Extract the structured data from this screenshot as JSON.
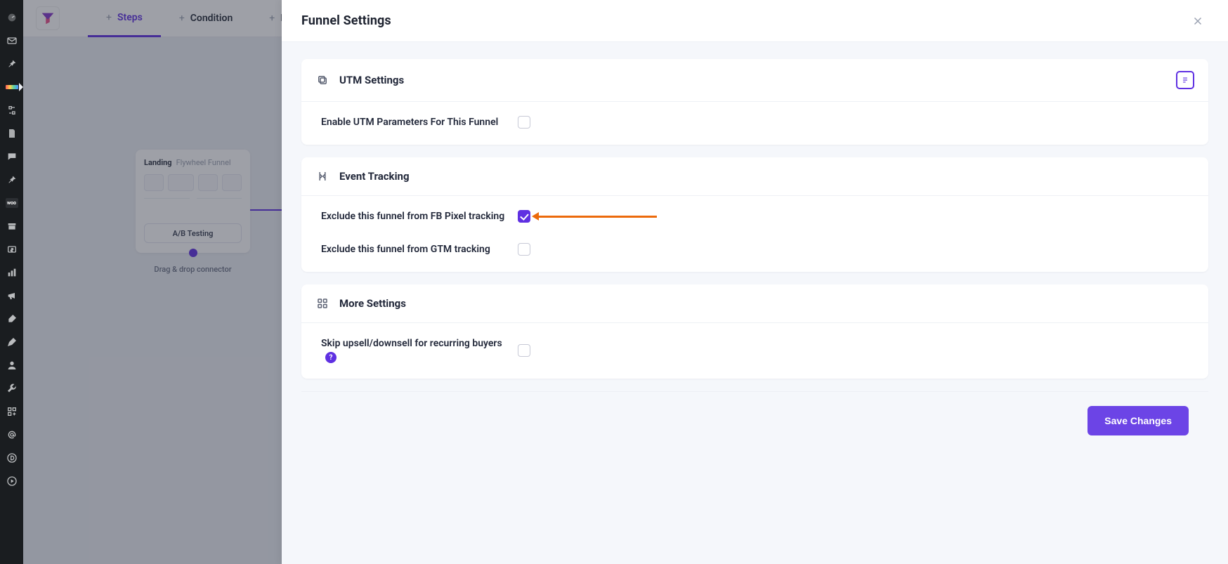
{
  "topbar": {
    "tabs": {
      "steps": "Steps",
      "condition": "Condition",
      "integrations": "Integrations"
    }
  },
  "node": {
    "tag": "Landing",
    "subtitle": "Flywheel Funnel",
    "ab_btn": "A/B Testing",
    "caption": "Drag & drop connector"
  },
  "panel": {
    "title": "Funnel Settings",
    "save_label": "Save Changes"
  },
  "sections": {
    "utm": {
      "title": "UTM Settings",
      "enable_label": "Enable UTM Parameters For This Funnel",
      "enable_checked": false
    },
    "events": {
      "title": "Event Tracking",
      "fb_label": "Exclude this funnel from FB Pixel tracking",
      "fb_checked": true,
      "gtm_label": "Exclude this funnel from GTM tracking",
      "gtm_checked": false
    },
    "more": {
      "title": "More Settings",
      "skip_label": "Skip upsell/downsell for recurring buyers",
      "skip_checked": false
    }
  }
}
